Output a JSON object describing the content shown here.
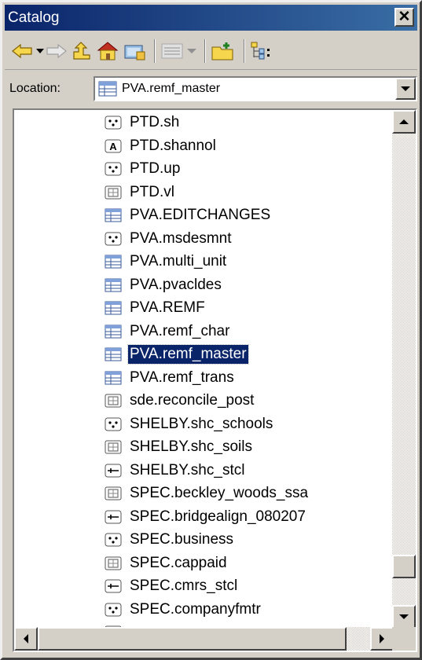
{
  "window": {
    "title": "Catalog",
    "close_label": "✕"
  },
  "toolbar": {
    "buttons": [
      "back-icon",
      "dropdown-arrow-icon",
      "forward-icon",
      "up-one-level-icon",
      "home-icon",
      "connect-folder-icon",
      "views-icon",
      "views-dropdown-icon",
      "new-item-icon",
      "tree-view-icon"
    ]
  },
  "location": {
    "label": "Location:",
    "value": "PVA.remf_master"
  },
  "tree": {
    "items": [
      {
        "label": "PTD.sh",
        "icon": "point-icon"
      },
      {
        "label": "PTD.shannol",
        "icon": "annotation-icon"
      },
      {
        "label": "PTD.up",
        "icon": "point-icon"
      },
      {
        "label": "PTD.vl",
        "icon": "raster-icon"
      },
      {
        "label": "PVA.EDITCHANGES",
        "icon": "table-icon"
      },
      {
        "label": "PVA.msdesmnt",
        "icon": "point-icon"
      },
      {
        "label": "PVA.multi_unit",
        "icon": "table-icon"
      },
      {
        "label": "PVA.pvacldes",
        "icon": "table-icon"
      },
      {
        "label": "PVA.REMF",
        "icon": "table-icon"
      },
      {
        "label": "PVA.remf_char",
        "icon": "table-icon"
      },
      {
        "label": "PVA.remf_master",
        "icon": "table-icon",
        "selected": true
      },
      {
        "label": "PVA.remf_trans",
        "icon": "table-icon"
      },
      {
        "label": "sde.reconcile_post",
        "icon": "raster-icon"
      },
      {
        "label": "SHELBY.shc_schools",
        "icon": "point-icon"
      },
      {
        "label": "SHELBY.shc_soils",
        "icon": "raster-icon"
      },
      {
        "label": "SHELBY.shc_stcl",
        "icon": "line-icon"
      },
      {
        "label": "SPEC.beckley_woods_ssa",
        "icon": "raster-icon"
      },
      {
        "label": "SPEC.bridgealign_080207",
        "icon": "line-icon"
      },
      {
        "label": "SPEC.business",
        "icon": "point-icon"
      },
      {
        "label": "SPEC.cappaid",
        "icon": "raster-icon"
      },
      {
        "label": "SPEC.cmrs_stcl",
        "icon": "line-icon"
      },
      {
        "label": "SPEC.companyfmtr",
        "icon": "point-icon"
      },
      {
        "label": "",
        "icon": "raster-icon"
      }
    ]
  }
}
